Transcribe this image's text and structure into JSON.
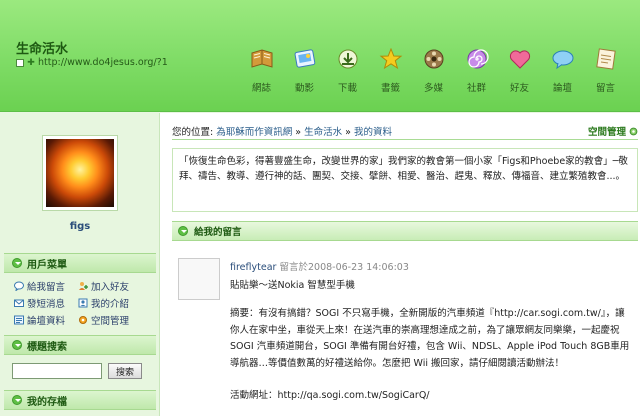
{
  "header": {
    "site_title": "生命活水",
    "site_url": "http://www.do4jesus.org/?1",
    "nav": [
      {
        "label": "網誌",
        "icon": "book-icon",
        "color": "#c98a2a"
      },
      {
        "label": "動影",
        "icon": "photo-icon",
        "color": "#4a9ad8"
      },
      {
        "label": "下載",
        "icon": "download-icon",
        "color": "#7aa63a"
      },
      {
        "label": "書籤",
        "icon": "star-icon",
        "color": "#f0c419"
      },
      {
        "label": "多媒",
        "icon": "film-icon",
        "color": "#8a6a3a"
      },
      {
        "label": "社群",
        "icon": "swirl-icon",
        "color": "#a35ad0"
      },
      {
        "label": "好友",
        "icon": "heart-icon",
        "color": "#e85a8a"
      },
      {
        "label": "論壇",
        "icon": "chat-icon",
        "color": "#5ab0e0"
      },
      {
        "label": "留言",
        "icon": "note-icon",
        "color": "#caa06a"
      }
    ]
  },
  "sidebar": {
    "username": "figs",
    "user_menu_title": "用戶菜單",
    "menu": [
      {
        "label": "給我留言",
        "icon": "chat-icon"
      },
      {
        "label": "加入好友",
        "icon": "add-user-icon"
      },
      {
        "label": "發短消息",
        "icon": "message-icon"
      },
      {
        "label": "我的介紹",
        "icon": "profile-icon"
      },
      {
        "label": "論壇資料",
        "icon": "forum-icon"
      },
      {
        "label": "空間管理",
        "icon": "settings-icon"
      }
    ],
    "tag_search_title": "標題搜索",
    "search_button": "搜索",
    "my_archive_title": "我的存檔"
  },
  "main": {
    "breadcrumb": {
      "prefix": "您的位置:",
      "items": [
        "為耶穌而作資訊網",
        "生命活水",
        "我的資料"
      ],
      "sep": "»"
    },
    "space_management": "空間管理",
    "intro": "「恢復生命色彩，得著豐盛生命，改變世界的家」我們家的教會第一個小家「Figs和Phoebe家的教會」─敬拜、禱告、教導、遵行神的話、團契、交接、擘餅、相愛、醫治、趕鬼、釋放、傳福音、建立繁殖教會...。",
    "section_title": "給我的留言",
    "comment": {
      "user": "fireflytear",
      "time_prefix": "留言於",
      "time": "2008-06-23 14:06:03",
      "title": "貼貼樂～送Nokia 智慧型手機",
      "body": "摘要：有沒有搞錯？SOGI 不只寫手機，全新開版的汽車頻道『http://car.sogi.com.tw/』，讓你人在家中坐，車從天上來！在送汽車的崇高理想達成之前，為了讓眾網友同樂樂，一起慶祝 SOGI 汽車頻道開台，SOGI 準備有開台好禮，包含 Wii、NDSL、Apple iPod Touch 8GB車用導航器…等價值數萬的好禮送給你。怎麼把 Wii 搬回家，請仔細閱讀活動辦法！",
      "link_label": "活動網址：",
      "link_url": "http://qa.sogi.com.tw/SogiCarQ/"
    }
  }
}
